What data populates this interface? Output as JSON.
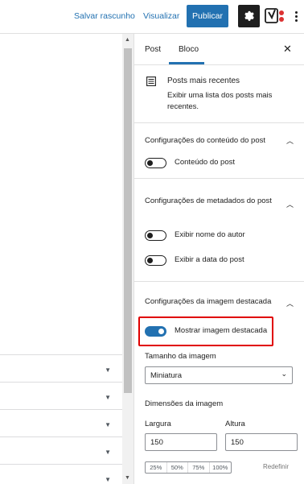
{
  "toolbar": {
    "save_draft": "Salvar rascunho",
    "preview": "Visualizar",
    "publish": "Publicar"
  },
  "sidebar": {
    "tabs": [
      "Post",
      "Bloco"
    ],
    "active_tab": "Bloco",
    "block": {
      "title": "Posts mais recentes",
      "description": "Exibir uma lista dos posts mais recentes."
    },
    "panels": {
      "content": {
        "title": "Configurações do conteúdo do post",
        "toggles": [
          {
            "label": "Conteúdo do post",
            "on": false
          }
        ]
      },
      "metadata": {
        "title": "Configurações de metadados do post",
        "toggles": [
          {
            "label": "Exibir nome do autor",
            "on": false
          },
          {
            "label": "Exibir a data do post",
            "on": false
          }
        ]
      },
      "featured_image": {
        "title": "Configurações da imagem destacada",
        "toggles": [
          {
            "label": "Mostrar imagem destacada",
            "on": true
          }
        ],
        "image_size_label": "Tamanho da imagem",
        "image_size_value": "Miniatura",
        "dimensions_label": "Dimensões da imagem",
        "width_label": "Largura",
        "width_value": "150",
        "height_label": "Altura",
        "height_value": "150",
        "percent_options": [
          "25%",
          "50%",
          "75%",
          "100%"
        ],
        "reset_label": "Redefinir"
      }
    }
  },
  "colors": {
    "accent": "#2271b1",
    "highlight": "#e00000"
  }
}
